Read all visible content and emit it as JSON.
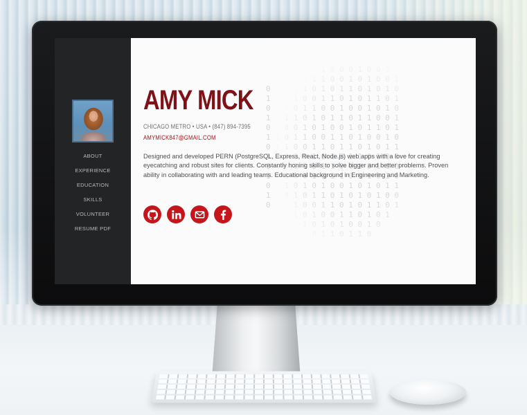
{
  "sidebar": {
    "avatar_alt": "Profile photo",
    "nav": [
      {
        "label": "ABOUT"
      },
      {
        "label": "EXPERIENCE"
      },
      {
        "label": "EDUCATION"
      },
      {
        "label": "SKILLS"
      },
      {
        "label": "VOLUNTEER"
      },
      {
        "label": "RESUME PDF"
      }
    ]
  },
  "profile": {
    "name": "AMY MICK",
    "location": "CHICAGO METRO • USA • (847) 894-7395",
    "email": "AMYMICK847@GMAIL.COM",
    "bio": "Designed and developed PERN (PostgreSQL, Express, React, Node.js) web apps with a love for creating eyecatching and robust sites for clients. Constantly honing skills to solve bigger and better problems. Proven ability in collaborating with and leading teams. Educational background in Engineering and Marketing."
  },
  "social": [
    {
      "icon": "github-icon"
    },
    {
      "icon": "linkedin-icon"
    },
    {
      "icon": "email-icon"
    },
    {
      "icon": "facebook-icon"
    }
  ],
  "colors": {
    "accent": "#c4161c",
    "name": "#7d1318",
    "sidebar": "#232426",
    "main_bg": "#fbfbfb"
  }
}
